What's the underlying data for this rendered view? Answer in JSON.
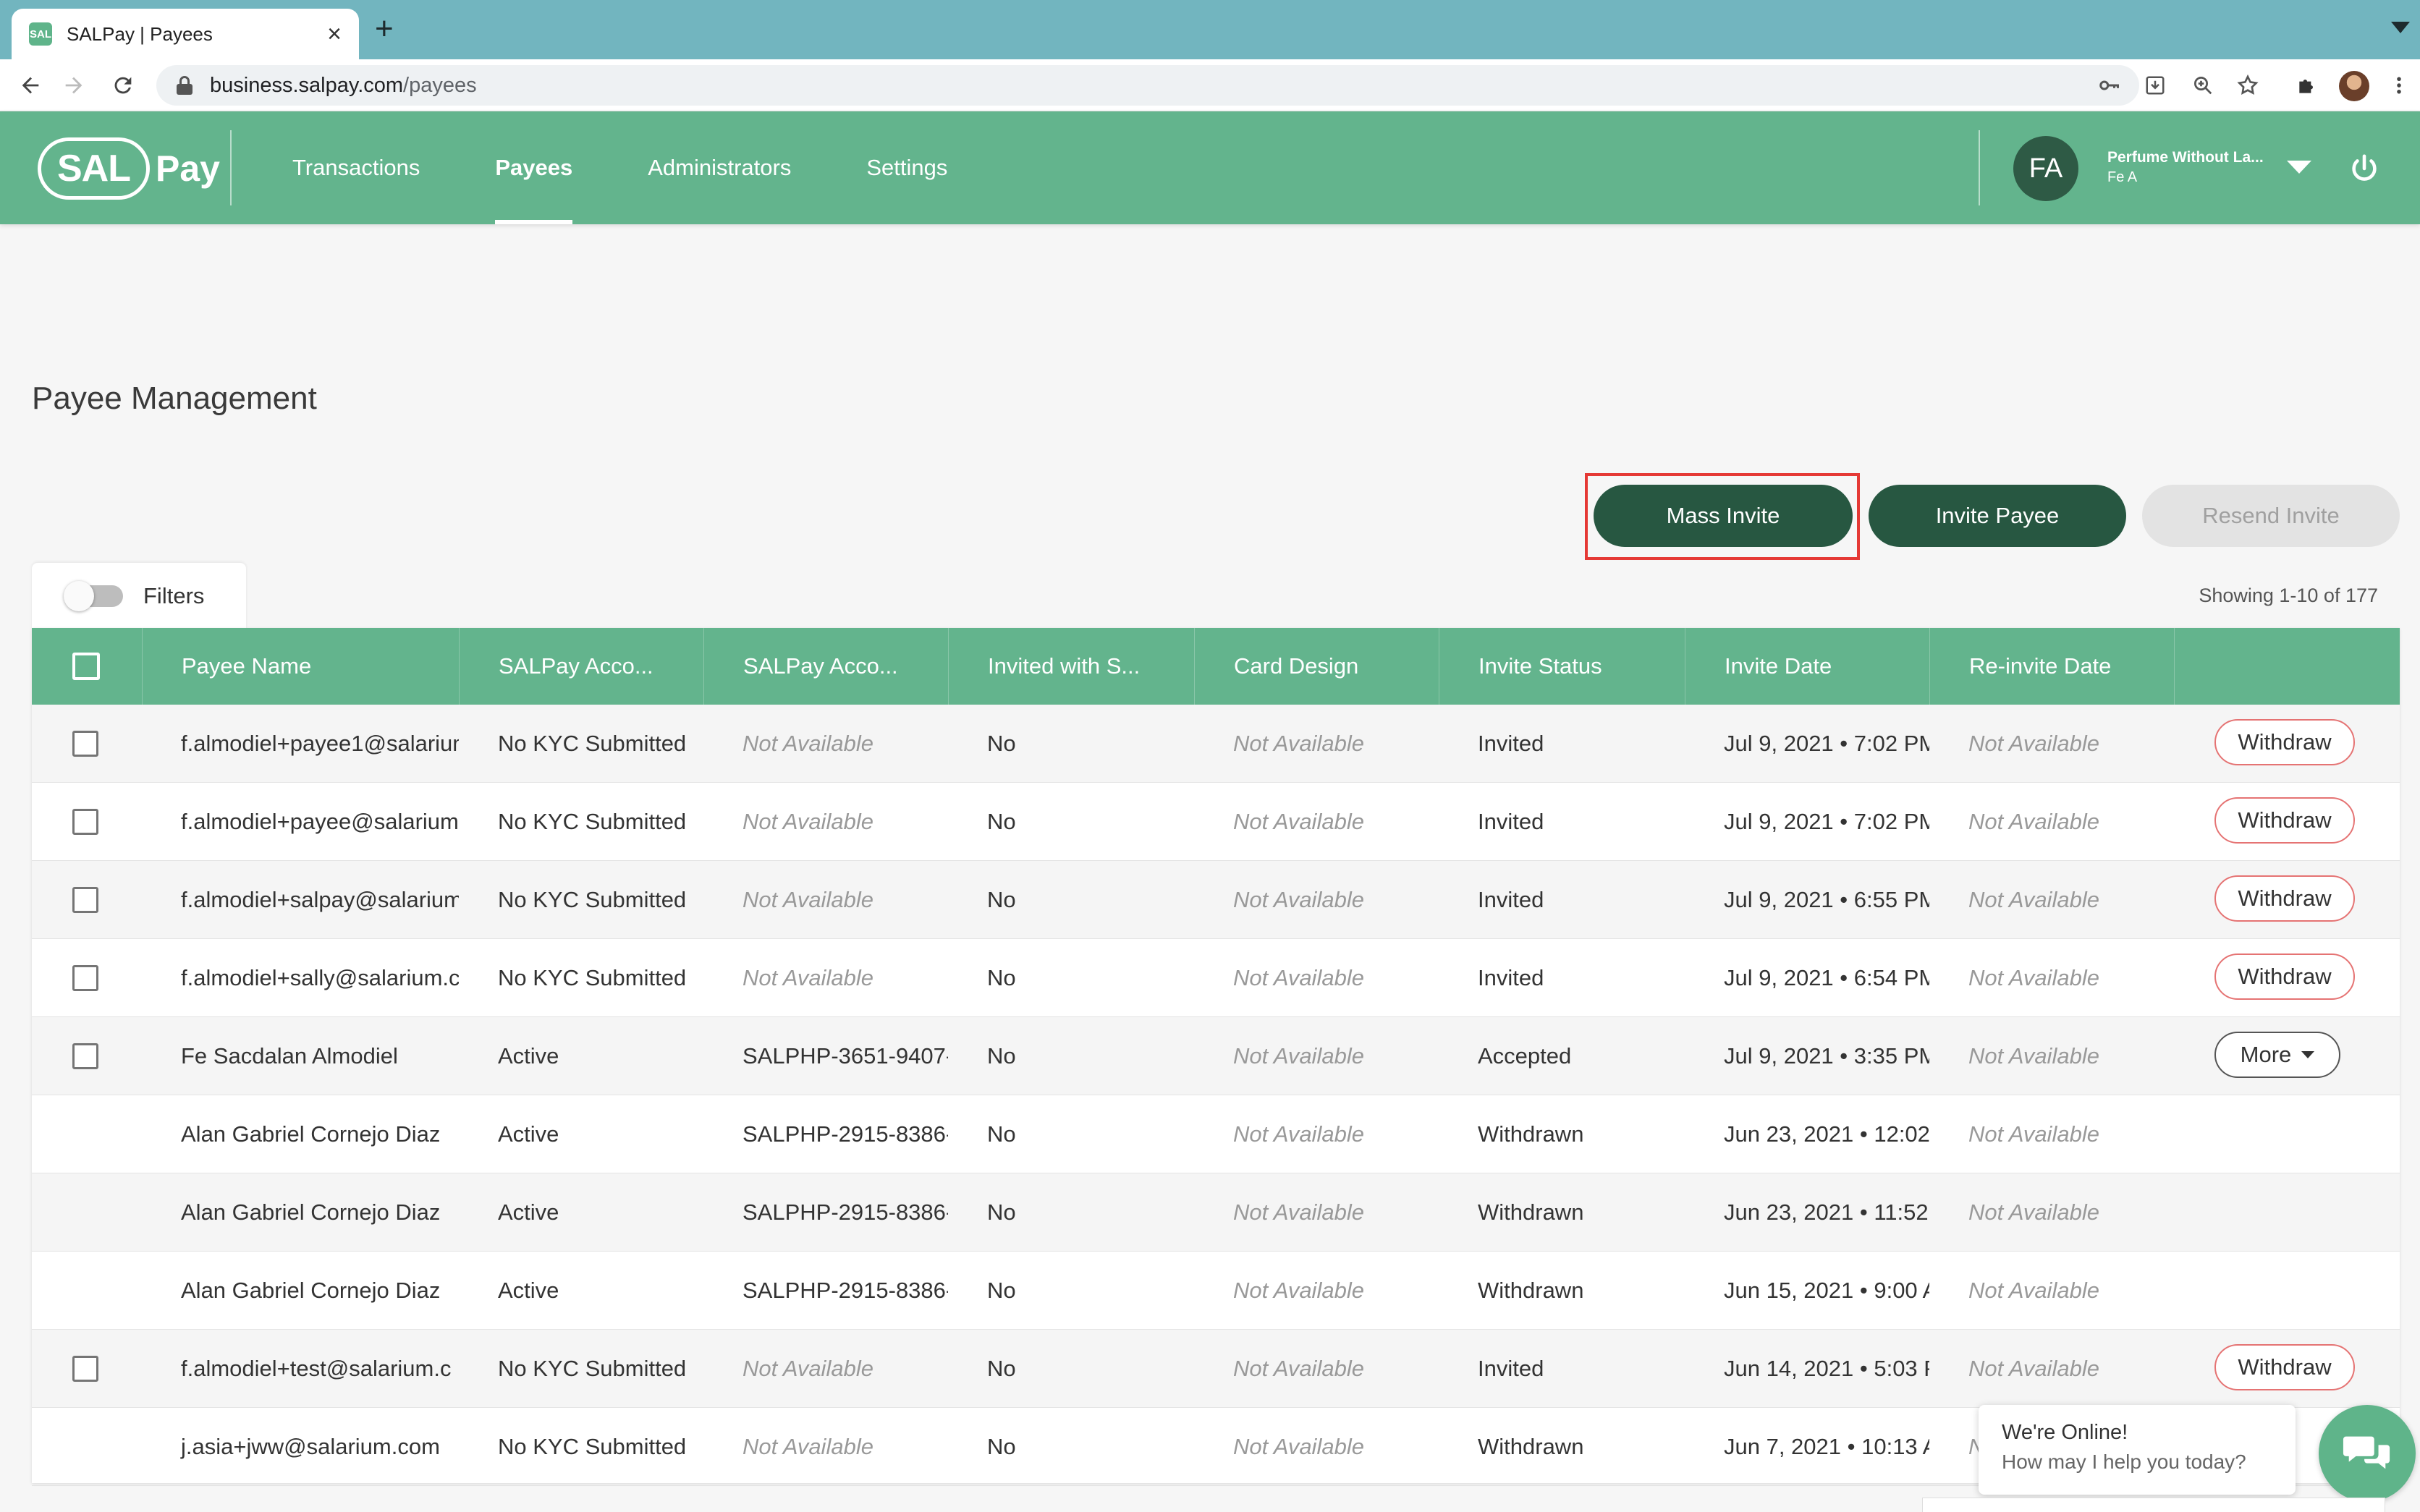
{
  "browser": {
    "tab_title": "SALPay | Payees",
    "favicon_text": "SAL",
    "url_host": "business.salpay.com",
    "url_path": "/payees"
  },
  "header": {
    "logo_sal": "SAL",
    "logo_pay": "Pay",
    "nav": [
      {
        "label": "Transactions",
        "active": false
      },
      {
        "label": "Payees",
        "active": true
      },
      {
        "label": "Administrators",
        "active": false
      },
      {
        "label": "Settings",
        "active": false
      }
    ],
    "avatar_initials": "FA",
    "org_name": "Perfume Without La...",
    "user_name": "Fe A"
  },
  "page": {
    "title": "Payee Management",
    "mass_invite_label": "Mass Invite",
    "invite_payee_label": "Invite Payee",
    "resend_invite_label": "Resend Invite",
    "filters_label": "Filters",
    "filters_enabled": false,
    "showing_text": "Showing 1-10 of 177"
  },
  "table": {
    "columns": [
      "Payee Name",
      "SALPay Acco...",
      "SALPay Acco...",
      "Invited with S...",
      "Card Design",
      "Invite Status",
      "Invite Date",
      "Re-invite Date"
    ],
    "rows": [
      {
        "checkbox": true,
        "name": "f.almodiel+payee1@salarium",
        "kyc": "No KYC Submitted",
        "account": "Not Available",
        "invited_with": "No",
        "card": "Not Available",
        "status": "Invited",
        "date": "Jul 9, 2021 • 7:02 PM",
        "reinvite": "Not Available",
        "action": "Withdraw"
      },
      {
        "checkbox": true,
        "name": "f.almodiel+payee@salarium",
        "kyc": "No KYC Submitted",
        "account": "Not Available",
        "invited_with": "No",
        "card": "Not Available",
        "status": "Invited",
        "date": "Jul 9, 2021 • 7:02 PM",
        "reinvite": "Not Available",
        "action": "Withdraw"
      },
      {
        "checkbox": true,
        "name": "f.almodiel+salpay@salarium",
        "kyc": "No KYC Submitted",
        "account": "Not Available",
        "invited_with": "No",
        "card": "Not Available",
        "status": "Invited",
        "date": "Jul 9, 2021 • 6:55 PM",
        "reinvite": "Not Available",
        "action": "Withdraw"
      },
      {
        "checkbox": true,
        "name": "f.almodiel+sally@salarium.c",
        "kyc": "No KYC Submitted",
        "account": "Not Available",
        "invited_with": "No",
        "card": "Not Available",
        "status": "Invited",
        "date": "Jul 9, 2021 • 6:54 PM",
        "reinvite": "Not Available",
        "action": "Withdraw"
      },
      {
        "checkbox": true,
        "name": "Fe Sacdalan Almodiel",
        "kyc": "Active",
        "account": "SALPHP-3651-9407-",
        "invited_with": "No",
        "card": "Not Available",
        "status": "Accepted",
        "date": "Jul 9, 2021 • 3:35 PM",
        "reinvite": "Not Available",
        "action": "More"
      },
      {
        "checkbox": false,
        "name": "Alan Gabriel Cornejo Diaz",
        "kyc": "Active",
        "account": "SALPHP-2915-8386-",
        "invited_with": "No",
        "card": "Not Available",
        "status": "Withdrawn",
        "date": "Jun 23, 2021 • 12:02",
        "reinvite": "Not Available",
        "action": ""
      },
      {
        "checkbox": false,
        "name": "Alan Gabriel Cornejo Diaz",
        "kyc": "Active",
        "account": "SALPHP-2915-8386-",
        "invited_with": "No",
        "card": "Not Available",
        "status": "Withdrawn",
        "date": "Jun 23, 2021 • 11:52",
        "reinvite": "Not Available",
        "action": ""
      },
      {
        "checkbox": false,
        "name": "Alan Gabriel Cornejo Diaz",
        "kyc": "Active",
        "account": "SALPHP-2915-8386-",
        "invited_with": "No",
        "card": "Not Available",
        "status": "Withdrawn",
        "date": "Jun 15, 2021 • 9:00 A",
        "reinvite": "Not Available",
        "action": ""
      },
      {
        "checkbox": true,
        "name": "f.almodiel+test@salarium.c",
        "kyc": "No KYC Submitted",
        "account": "Not Available",
        "invited_with": "No",
        "card": "Not Available",
        "status": "Invited",
        "date": "Jun 14, 2021 • 5:03 P",
        "reinvite": "Not Available",
        "action": "Withdraw"
      },
      {
        "checkbox": false,
        "name": "j.asia+jww@salarium.com",
        "kyc": "No KYC Submitted",
        "account": "Not Available",
        "invited_with": "No",
        "card": "Not Available",
        "status": "Withdrawn",
        "date": "Jun 7, 2021 • 10:13 A",
        "reinvite": "N",
        "action": ""
      }
    ]
  },
  "chat": {
    "title": "We're Online!",
    "subtitle": "How may I help you today?"
  },
  "colors": {
    "header_green": "#63b48d",
    "dark_green": "#275741",
    "tab_bar": "#72b5bf",
    "withdraw_border": "#e57373",
    "highlight_red": "#e53935"
  }
}
